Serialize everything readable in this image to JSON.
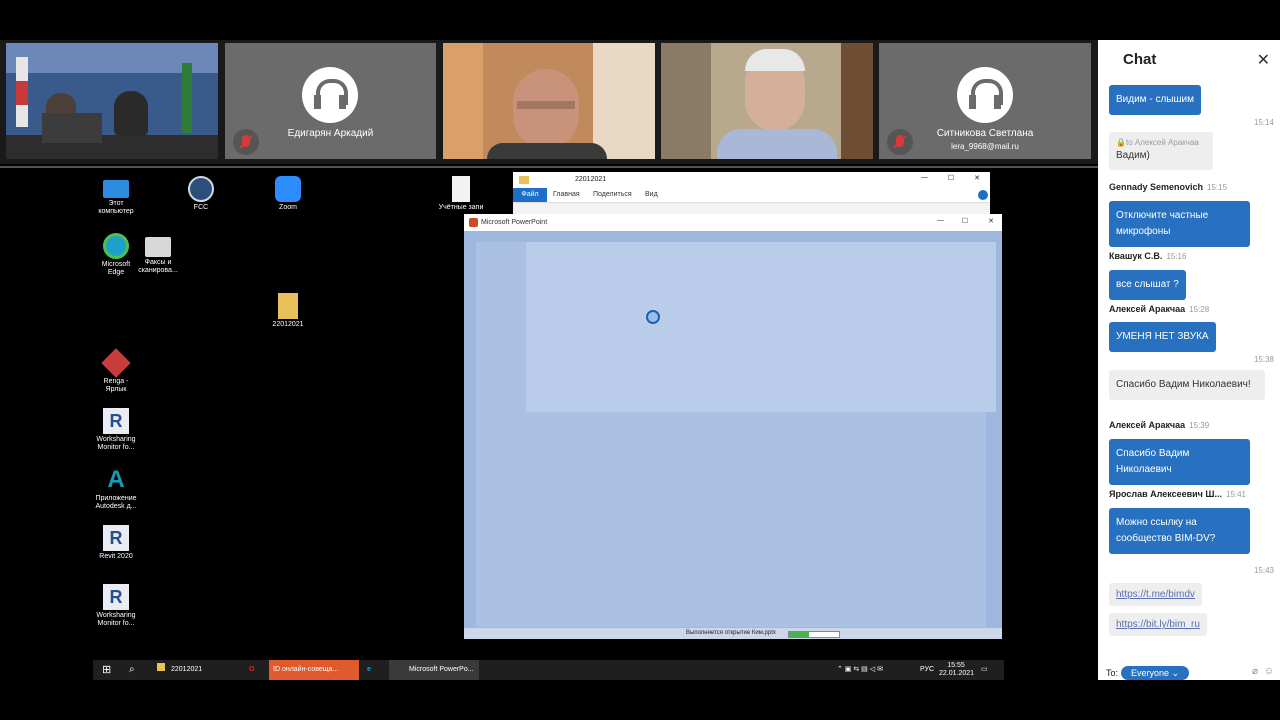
{
  "video_tiles": [
    {
      "name": "",
      "type": "video"
    },
    {
      "name": "Едигарян Аркадий",
      "type": "placeholder",
      "muted": true
    },
    {
      "name": "",
      "type": "video"
    },
    {
      "name": "",
      "type": "video"
    },
    {
      "name": "Ситникова Светлана",
      "email": "lera_9968@mail.ru",
      "type": "placeholder",
      "muted": true
    }
  ],
  "desktop": {
    "icons": [
      {
        "label": "Этот компьютер",
        "icon": "computer-icon"
      },
      {
        "label": "FCC",
        "icon": "camera-icon"
      },
      {
        "label": "Zoom",
        "icon": "zoom-icon"
      },
      {
        "label": "Учётные запи",
        "icon": "document-icon"
      },
      {
        "label": "Microsoft Edge",
        "icon": "edge-icon"
      },
      {
        "label": "Факсы и сканирова...",
        "icon": "printer-icon"
      },
      {
        "label": "22012021",
        "icon": "zip-folder-icon"
      },
      {
        "label": "Renga - Ярлык",
        "icon": "renga-icon"
      },
      {
        "label": "Worksharing Monitor fo...",
        "icon": "revit-icon"
      },
      {
        "label": "Приложение Autodesk д...",
        "icon": "autodesk-icon"
      },
      {
        "label": "Revit 2020",
        "icon": "revit-icon"
      },
      {
        "label": "Worksharing Monitor fo...",
        "icon": "revit-icon"
      }
    ],
    "explorer": {
      "title": "22012021",
      "tabs": [
        "Файл",
        "Главная",
        "Поделиться",
        "Вид"
      ]
    },
    "powerpoint": {
      "title": "Microsoft PowerPoint",
      "status": "Выполняется открытие Ким.pptx"
    },
    "taskbar": {
      "items": [
        "22012021",
        "ID онлайн-совеща...",
        "Microsoft PowerPo..."
      ],
      "lang": "РУС",
      "time": "15:55",
      "date": "22.01.2021"
    }
  },
  "chat": {
    "title": "Chat",
    "messages": [
      {
        "sender": "",
        "time": "",
        "text": "Видим - слышим",
        "style": "blue"
      },
      {
        "time_after": "15:14"
      },
      {
        "private_to": "to Алексей Аракчаа",
        "text": "Вадим)",
        "style": "grey"
      },
      {
        "sender": "Gennady Semenovich",
        "time": "15:15",
        "text": "Отключите частные микрофоны",
        "style": "blue"
      },
      {
        "sender": "Квашук С.В.",
        "time": "15:16",
        "text": "все слышат ?",
        "style": "blue"
      },
      {
        "sender": "Алексей Аракчаа",
        "time": "15:28",
        "text": "УМЕНЯ НЕТ ЗВУКА",
        "style": "blue"
      },
      {
        "time_after": "15:38"
      },
      {
        "text": "Спасибо Вадим Николаевич!",
        "style": "grey"
      },
      {
        "sender": "Алексей Аракчаа",
        "time": "15:39",
        "text": "Спасибо Вадим Николаевич",
        "style": "blue"
      },
      {
        "sender": "Ярослав Алексеевич Ш...",
        "time": "15:41",
        "text": "Можно ссылку на сообщество BIM-DV?",
        "style": "blue"
      },
      {
        "time_after": "15:43"
      },
      {
        "link": "https://t.me/bimdv"
      },
      {
        "link": "https://bit.ly/bim_ru"
      }
    ],
    "to_label": "To:",
    "recipient": "Everyone"
  }
}
